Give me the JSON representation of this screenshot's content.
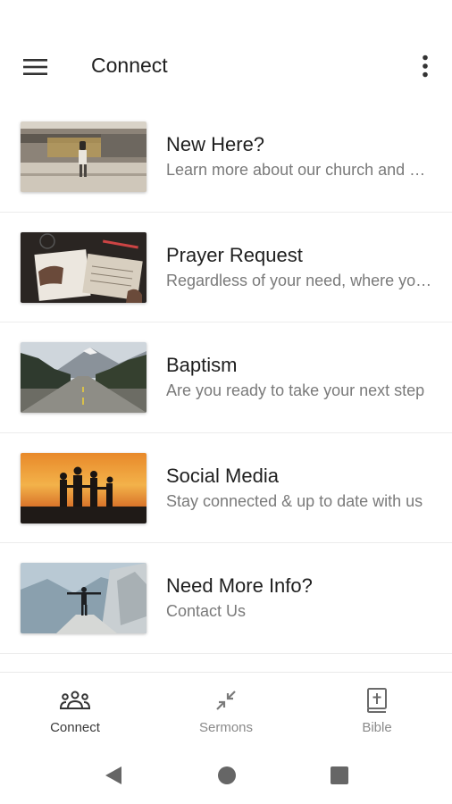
{
  "appbar": {
    "title": "Connect",
    "menu_icon": "hamburger-menu-icon",
    "more_icon": "more-vertical-icon"
  },
  "items": [
    {
      "title": "New Here?",
      "subtitle": "Learn more about our church and what we're about",
      "image": "train-platform-photo"
    },
    {
      "title": "Prayer Request",
      "subtitle": "Regardless of your need, where you are",
      "image": "bible-journal-photo"
    },
    {
      "title": "Baptism",
      "subtitle": "Are you ready to take your next step",
      "image": "mountain-road-photo"
    },
    {
      "title": "Social Media",
      "subtitle": "Stay connected & up to date with us",
      "image": "sunset-family-photo"
    },
    {
      "title": "Need More Info?",
      "subtitle": "Contact Us",
      "image": "mountain-summit-photo"
    }
  ],
  "bottom_nav": {
    "tabs": [
      {
        "label": "Connect",
        "icon": "people-group-icon",
        "active": true
      },
      {
        "label": "Sermons",
        "icon": "compress-arrows-icon",
        "active": false
      },
      {
        "label": "Bible",
        "icon": "bible-cross-icon",
        "active": false
      }
    ]
  },
  "system_nav": {
    "back_icon": "back-triangle-icon",
    "home_icon": "home-circle-icon",
    "recents_icon": "recents-square-icon"
  },
  "colors": {
    "title": "#212121",
    "subtitle": "#7a7a7a",
    "icon": "#333333",
    "inactive": "#8a8a8a"
  }
}
